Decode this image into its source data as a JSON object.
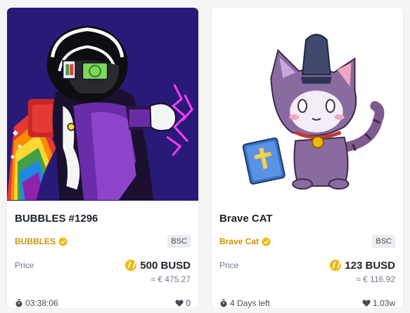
{
  "cards": [
    {
      "title": "BUBBLES #1296",
      "collection": "BUBBLES",
      "chain": "BSC",
      "price_label": "Price",
      "price": "500 BUSD",
      "fiat": "≈ € 475.27",
      "time": "03:38:06",
      "likes": "0"
    },
    {
      "title": "Brave CAT",
      "collection": "Brave Cat",
      "chain": "BSC",
      "price_label": "Price",
      "price": "123 BUSD",
      "fiat": "≈ € 116.92",
      "time": "4 Days left",
      "likes": "1.03w"
    }
  ],
  "colors": {
    "accent": "#c99400",
    "coin": "#f0b90b",
    "background": "#f5f5f5"
  },
  "icons": [
    "verified-badge-icon",
    "busd-coin-icon",
    "stopwatch-icon",
    "heart-icon"
  ]
}
